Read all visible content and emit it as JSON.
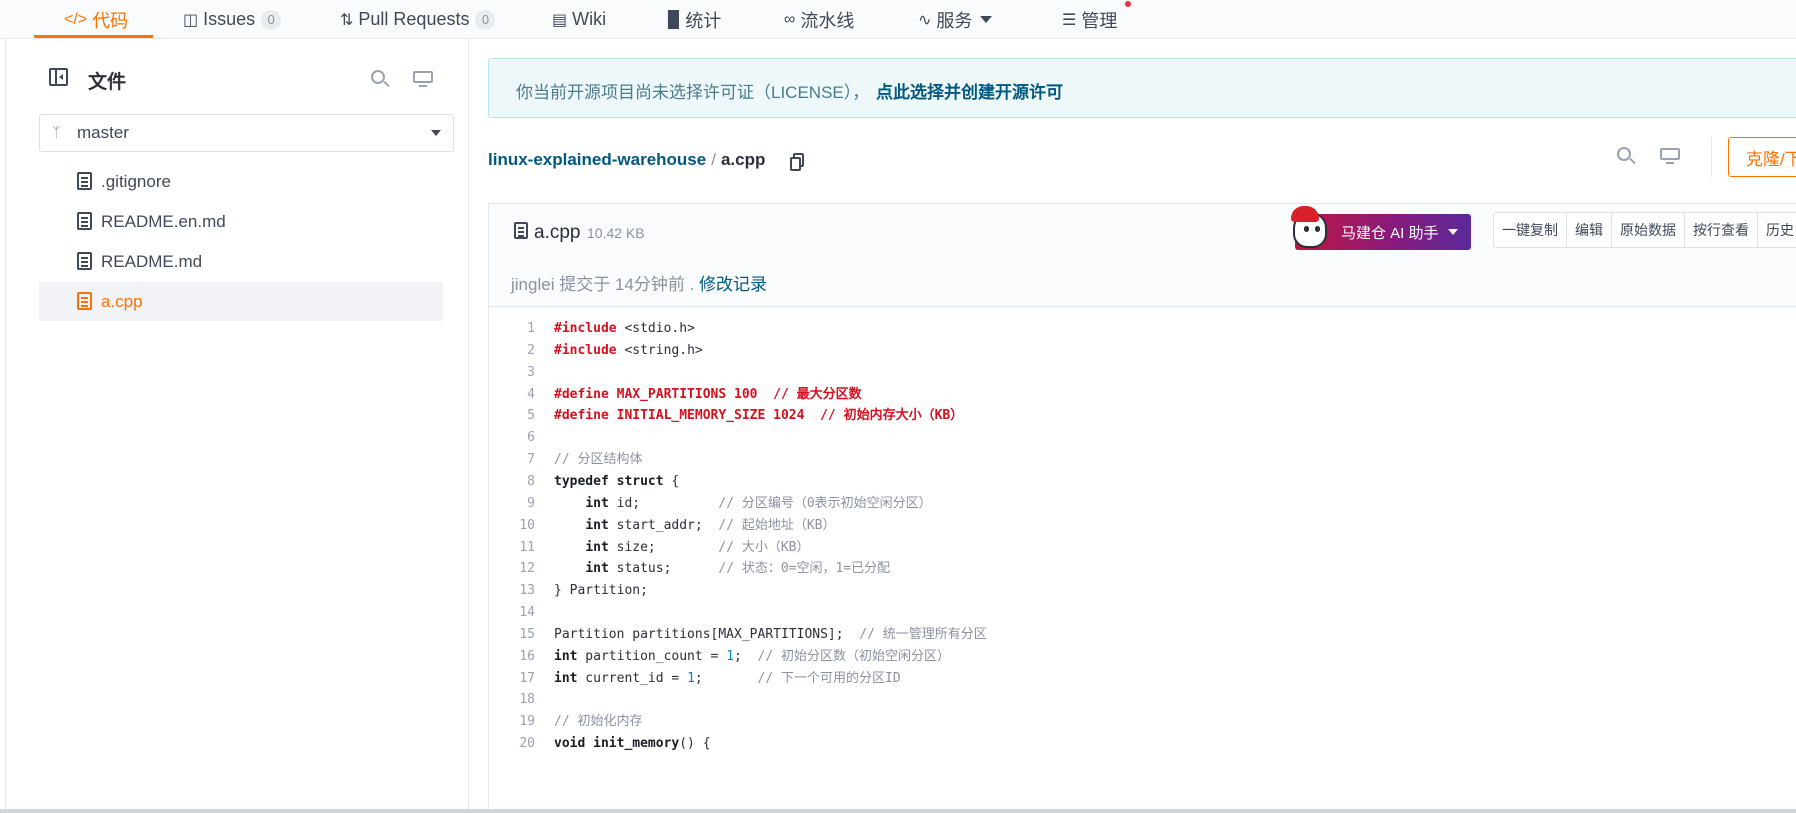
{
  "tabs": [
    {
      "icon": "code-icon",
      "label": "代码",
      "active": true
    },
    {
      "icon": "issues-icon",
      "label": "Issues",
      "count": "0"
    },
    {
      "icon": "pull-request-icon",
      "label": "Pull Requests",
      "count": "0"
    },
    {
      "icon": "wiki-icon",
      "label": "Wiki"
    },
    {
      "icon": "stats-icon",
      "label": "统计"
    },
    {
      "icon": "pipeline-icon",
      "label": "流水线"
    },
    {
      "icon": "services-icon",
      "label": "服务"
    },
    {
      "icon": "manage-icon",
      "label": "管理"
    }
  ],
  "sidebar": {
    "title": "文件",
    "branch": "master",
    "files": [
      {
        "name": ".gitignore",
        "selected": false
      },
      {
        "name": "README.en.md",
        "selected": false
      },
      {
        "name": "README.md",
        "selected": false
      },
      {
        "name": "a.cpp",
        "selected": true
      }
    ]
  },
  "license_notice": {
    "text": "你当前开源项目尚未选择许可证（LICENSE），",
    "link": "点此选择并创建开源许可"
  },
  "breadcrumb": {
    "repo": "linux-explained-warehouse",
    "separator": "/",
    "file": "a.cpp"
  },
  "clone_button": "克隆/下载",
  "file_header": {
    "name": "a.cpp",
    "size": "10.42 KB",
    "commit_text": "jinglei 提交于 14分钟前 .",
    "history_link": "修改记录",
    "ai_assistant": "马建仓 AI 助手",
    "actions": [
      "一键复制",
      "编辑",
      "原始数据",
      "按行查看",
      "历史"
    ]
  },
  "code_lines": [
    {
      "n": "1",
      "html": "<span class='pp'>#include</span> &lt;stdio.h&gt;"
    },
    {
      "n": "2",
      "html": "<span class='pp'>#include</span> &lt;string.h&gt;"
    },
    {
      "n": "3",
      "html": ""
    },
    {
      "n": "4",
      "html": "<span class='pp'>#define MAX_PARTITIONS 100  // 最大分区数</span>"
    },
    {
      "n": "5",
      "html": "<span class='pp'>#define INITIAL_MEMORY_SIZE 1024  // 初始内存大小（KB）</span>"
    },
    {
      "n": "6",
      "html": ""
    },
    {
      "n": "7",
      "html": "<span class='cm'>// 分区结构体</span>"
    },
    {
      "n": "8",
      "html": "<span class='kw'>typedef</span> <span class='kw'>struct</span> {"
    },
    {
      "n": "9",
      "html": "    <span class='kw'>int</span> id;          <span class='cm'>// 分区编号（0表示初始空闲分区）</span>"
    },
    {
      "n": "10",
      "html": "    <span class='kw'>int</span> start_addr;  <span class='cm'>// 起始地址（KB）</span>"
    },
    {
      "n": "11",
      "html": "    <span class='kw'>int</span> size;        <span class='cm'>// 大小（KB）</span>"
    },
    {
      "n": "12",
      "html": "    <span class='kw'>int</span> status;      <span class='cm'>// 状态：0=空闲，1=已分配</span>"
    },
    {
      "n": "13",
      "html": "} Partition;"
    },
    {
      "n": "14",
      "html": ""
    },
    {
      "n": "15",
      "html": "Partition partitions[MAX_PARTITIONS];  <span class='cm'>// 统一管理所有分区</span>"
    },
    {
      "n": "16",
      "html": "<span class='kw'>int</span> partition_count = <span class='num'>1</span>;  <span class='cm'>// 初始分区数（初始空闲分区）</span>"
    },
    {
      "n": "17",
      "html": "<span class='kw'>int</span> current_id = <span class='num'>1</span>;       <span class='cm'>// 下一个可用的分区ID</span>"
    },
    {
      "n": "18",
      "html": ""
    },
    {
      "n": "19",
      "html": "<span class='cm'>// 初始化内存</span>"
    },
    {
      "n": "20",
      "html": "<span class='kw'>void</span> <span class='kw'>init_memory</span>() {"
    }
  ]
}
